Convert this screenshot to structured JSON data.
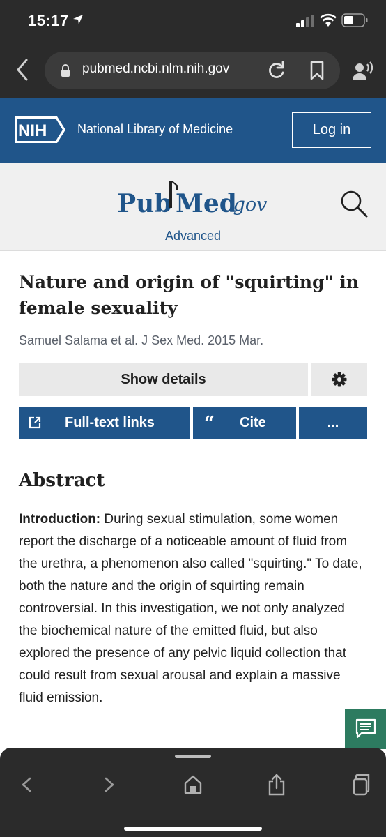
{
  "status_bar": {
    "time": "15:17"
  },
  "browser": {
    "url": "pubmed.ncbi.nlm.nih.gov"
  },
  "nih_header": {
    "logo_text": "NIH",
    "library_name": "National Library of Medicine",
    "login_label": "Log in"
  },
  "pubmed": {
    "logo_pub": "Pub",
    "logo_med": "Med",
    "logo_gov": ".gov",
    "advanced_label": "Advanced"
  },
  "article": {
    "title": "Nature and origin of \"squirting\" in female sexuality",
    "authors_line": "Samuel Salama et al. J Sex Med. 2015 Mar.",
    "show_details_label": "Show details",
    "full_text_links_label": "Full-text links",
    "cite_label": "Cite",
    "more_label": "..."
  },
  "abstract": {
    "heading": "Abstract",
    "intro_label": "Introduction:",
    "intro_text": " During sexual stimulation, some women report the discharge of a noticeable amount of fluid from the urethra, a phenomenon also called \"squirting.\" To date, both the nature and the origin of squirting remain controversial. In this investigation, we not only analyzed the biochemical nature of the emitted fluid, but also explored the presence of any pelvic liquid collection that could result from sexual arousal and explain a massive fluid emission."
  },
  "colors": {
    "nih_blue": "#20558a",
    "browser_dark": "#2b2b2b",
    "feedback_green": "#2d7b60",
    "pubmed_gray_bg": "#f0f0f0"
  },
  "icons": [
    "location-arrow-icon",
    "signal-icon",
    "wifi-icon",
    "battery-icon",
    "back-icon",
    "lock-icon",
    "reload-icon",
    "bookmark-icon",
    "voice-icon",
    "search-icon",
    "gear-icon",
    "external-link-icon",
    "quote-icon",
    "feedback-icon",
    "forward-icon",
    "home-icon",
    "share-icon",
    "tabs-icon"
  ]
}
